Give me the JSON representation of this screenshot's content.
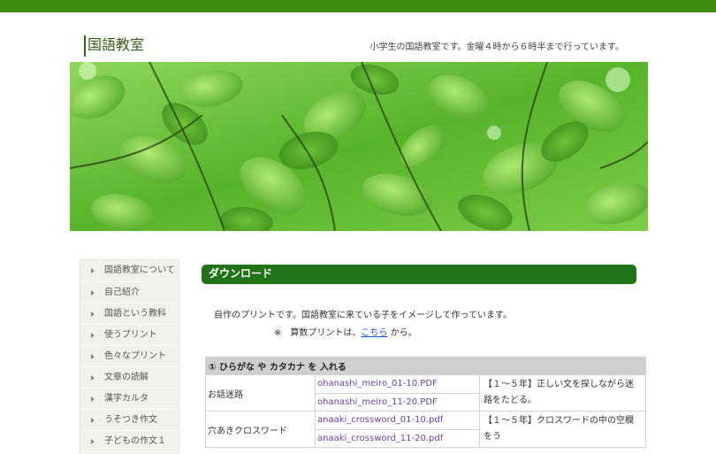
{
  "header": {
    "site_title": "国語教室",
    "tagline": "小学生の国語教室です。金曜４時から６時半まで行っています。"
  },
  "sidebar": {
    "items": [
      {
        "label": "国語教室について"
      },
      {
        "label": "自己紹介"
      },
      {
        "label": "国語という教科"
      },
      {
        "label": "使うプリント"
      },
      {
        "label": "色々なプリント"
      },
      {
        "label": "文章の読解"
      },
      {
        "label": "漢字カルタ"
      },
      {
        "label": "うそつき作文"
      },
      {
        "label": "子どもの作文１"
      }
    ]
  },
  "main": {
    "section_title": "ダウンロード",
    "intro_line1": "自作のプリントです。国語教室に来ている子をイメージして作っています。",
    "intro_prefix": "※　算数プリントは、",
    "intro_link": "こちら",
    "intro_suffix": " から。",
    "table": {
      "category": "① ひらがな や カタカナ を 入れる",
      "rows": [
        {
          "name": "お話迷路",
          "files": [
            "ohanashi_meiro_01-10.PDF",
            "ohanashi_meiro_11-20.PDF"
          ],
          "desc": "【１～５年】正しい文を探しながら迷路をたどる。"
        },
        {
          "name": "穴あきクロスワード",
          "files": [
            "anaaki_crossword_01-10.pdf",
            "anaaki_crossword_11-20.pdf"
          ],
          "desc": "【１～５年】クロスワードの中の空欄をう"
        }
      ]
    }
  },
  "colors": {
    "topbar": "#3c8c12",
    "section_head": "#207417",
    "link": "#1a56c8",
    "file_link": "#6a40a0"
  }
}
